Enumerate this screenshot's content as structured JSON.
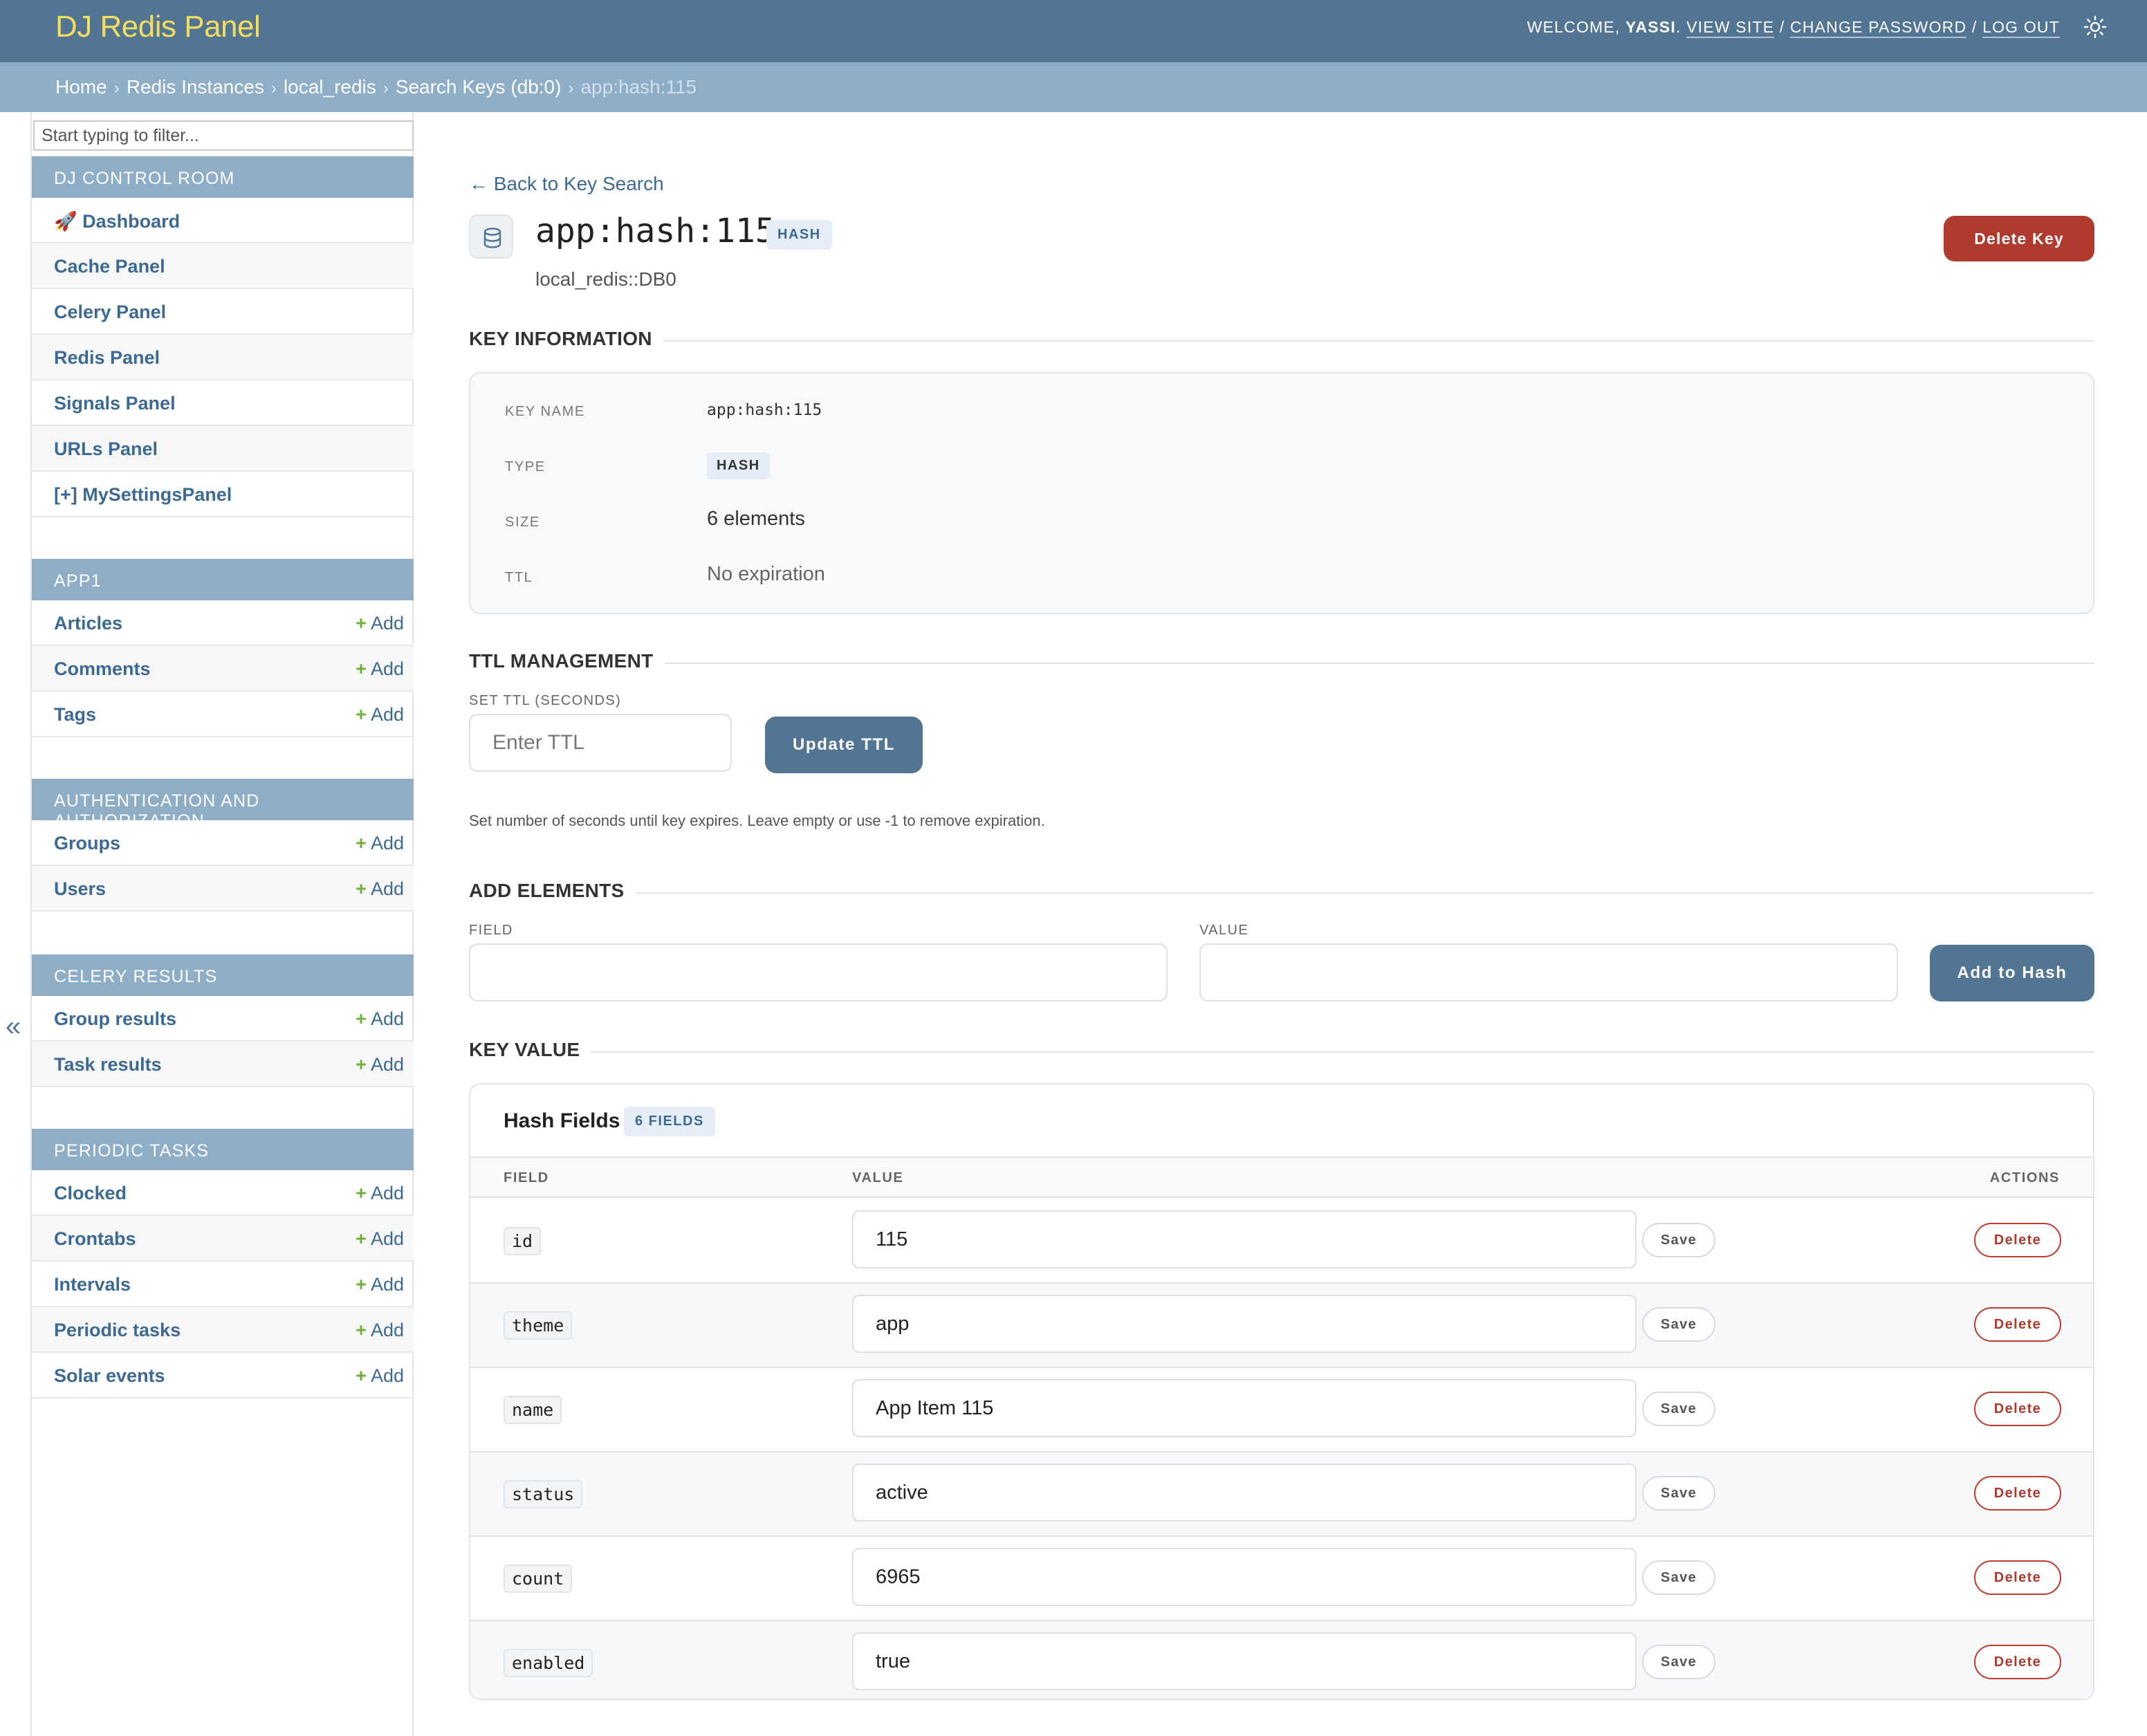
{
  "header": {
    "site_name": "DJ Redis Panel",
    "welcome_prefix": "WELCOME, ",
    "username": "YASSI",
    "welcome_suffix": ". ",
    "view_site": "VIEW SITE",
    "change_password": "CHANGE PASSWORD",
    "log_out": "LOG OUT",
    "separator": " / ",
    "theme_icon": "sun-icon"
  },
  "breadcrumbs": {
    "items": [
      "Home",
      "Redis Instances",
      "local_redis",
      "Search Keys (db:0)"
    ],
    "current": "app:hash:115",
    "separator": "›"
  },
  "sidebar": {
    "filter_placeholder": "Start typing to filter...",
    "add_label": "Add",
    "collapse_icon": "«",
    "modules": [
      {
        "caption": "DJ CONTROL ROOM",
        "rows": [
          {
            "label": "🚀 Dashboard"
          },
          {
            "label": "Cache Panel"
          },
          {
            "label": "Celery Panel"
          },
          {
            "label": "Redis Panel"
          },
          {
            "label": "Signals Panel"
          },
          {
            "label": "URLs Panel"
          },
          {
            "label": "[+] MySettingsPanel"
          }
        ]
      },
      {
        "caption": "APP1",
        "rows": [
          {
            "label": "Articles"
          },
          {
            "label": "Comments"
          },
          {
            "label": "Tags"
          }
        ]
      },
      {
        "caption": "AUTHENTICATION AND AUTHORIZATION",
        "rows": [
          {
            "label": "Groups"
          },
          {
            "label": "Users"
          }
        ]
      },
      {
        "caption": "CELERY RESULTS",
        "rows": [
          {
            "label": "Group results"
          },
          {
            "label": "Task results"
          }
        ]
      },
      {
        "caption": "PERIODIC TASKS",
        "rows": [
          {
            "label": "Clocked"
          },
          {
            "label": "Crontabs"
          },
          {
            "label": "Intervals"
          },
          {
            "label": "Periodic tasks"
          },
          {
            "label": "Solar events"
          }
        ]
      }
    ]
  },
  "main": {
    "back_link": "← Back to Key Search",
    "key_name": "app:hash:115",
    "key_type_badge": "HASH",
    "subtitle": "local_redis::DB0",
    "delete_key_label": "Delete Key",
    "key_information": {
      "heading": "KEY INFORMATION",
      "key_name_label": "KEY NAME",
      "key_name_value": "app:hash:115",
      "type_label": "TYPE",
      "type_value": "HASH",
      "size_label": "SIZE",
      "size_value": "6 elements",
      "ttl_label": "TTL",
      "ttl_value": "No expiration"
    },
    "ttl_management": {
      "heading": "TTL MANAGEMENT",
      "field_label": "SET TTL (SECONDS)",
      "placeholder": "Enter TTL",
      "button_label": "Update TTL",
      "help_text": "Set number of seconds until key expires. Leave empty or use -1 to remove expiration."
    },
    "add_elements": {
      "heading": "ADD ELEMENTS",
      "field_label": "FIELD",
      "value_label": "VALUE",
      "field_value": "",
      "value_value": "",
      "button_label": "Add to Hash"
    },
    "key_value": {
      "heading": "KEY VALUE",
      "card_title": "Hash Fields",
      "count_badge": "6 FIELDS",
      "columns": {
        "field": "FIELD",
        "value": "VALUE",
        "actions": "ACTIONS"
      },
      "save_label": "Save",
      "delete_label": "Delete",
      "rows": [
        {
          "field": "id",
          "value": "115"
        },
        {
          "field": "theme",
          "value": "app"
        },
        {
          "field": "name",
          "value": "App Item 115"
        },
        {
          "field": "status",
          "value": "active"
        },
        {
          "field": "count",
          "value": "6965"
        },
        {
          "field": "enabled",
          "value": "true"
        }
      ]
    }
  },
  "colors": {
    "header_bg": "#537594",
    "breadcrumb_bg": "#8eaec8",
    "brand_yellow": "#f5dd5d",
    "link_blue": "#3c6a93",
    "add_green": "#6fb03a",
    "danger_red": "#b03a2e"
  }
}
